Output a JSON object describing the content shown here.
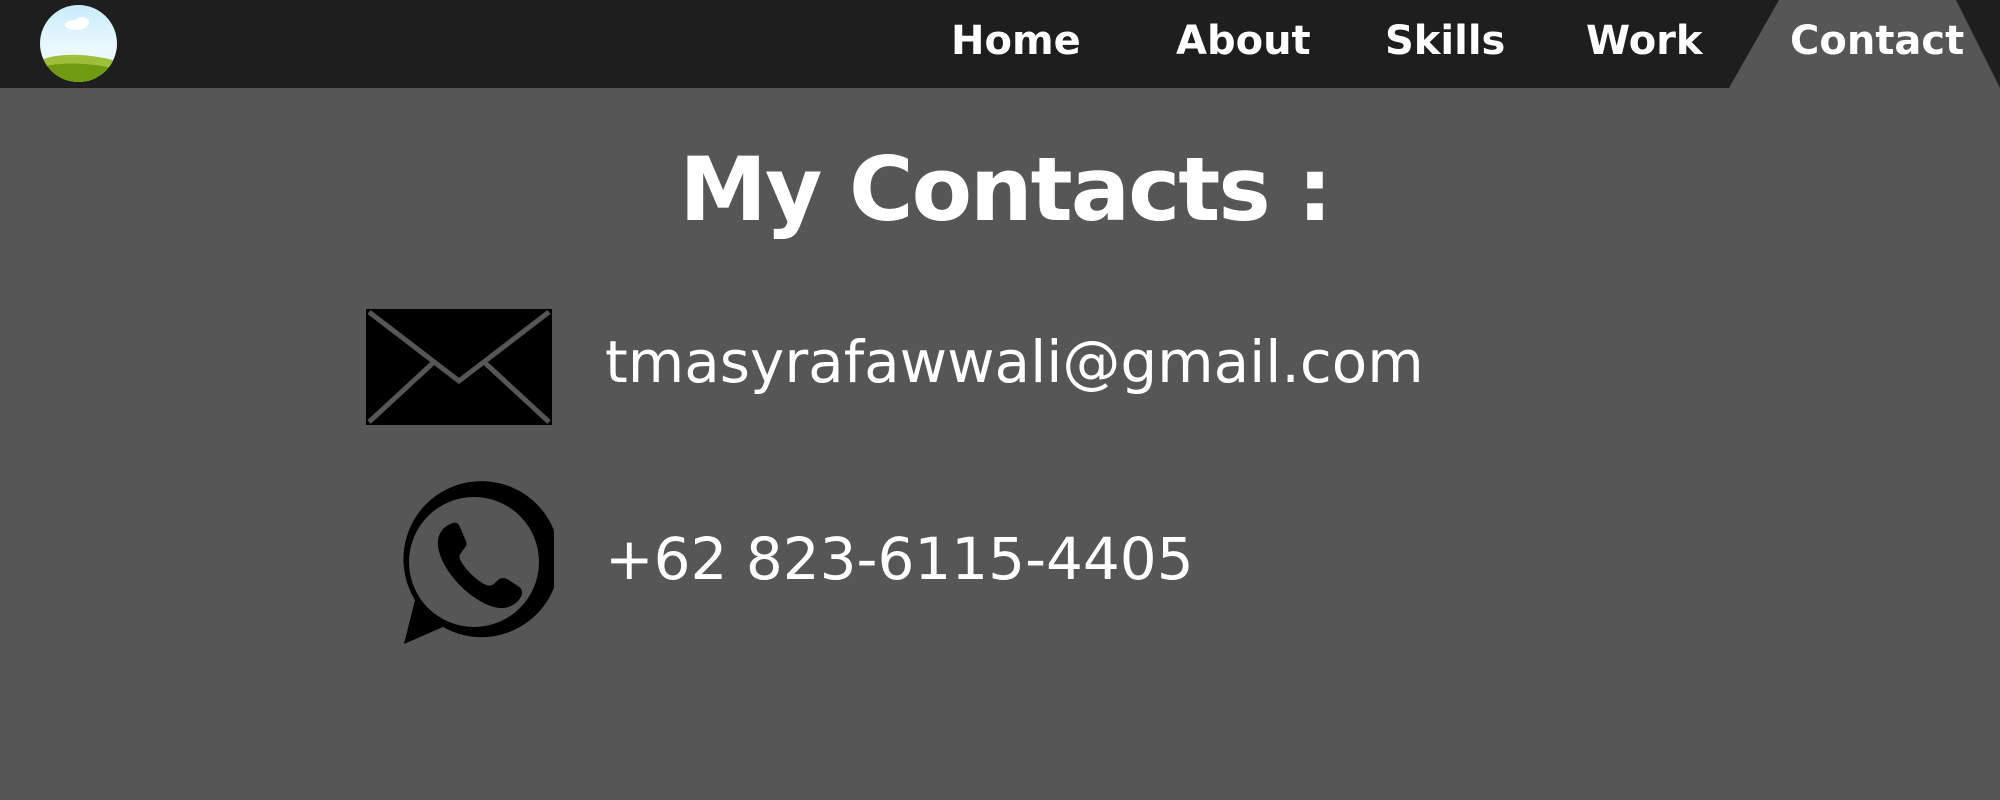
{
  "header": {
    "logo_icon": "landscape-sky-grass-icon",
    "nav": {
      "home": "Home",
      "about": "About",
      "skills": "Skills",
      "work": "Work",
      "contact": "Contact"
    },
    "active_item": "Contact",
    "colors": {
      "background": "#1e1e1e",
      "active_tab": "#565656",
      "text": "#ffffff"
    }
  },
  "main": {
    "title": "My Contacts :",
    "background": "#565656",
    "contacts": [
      {
        "icon": "envelope-icon",
        "text": "tmasyrafawwali@gmail.com"
      },
      {
        "icon": "whatsapp-icon",
        "text": "+62 823-6115-4405"
      }
    ]
  }
}
